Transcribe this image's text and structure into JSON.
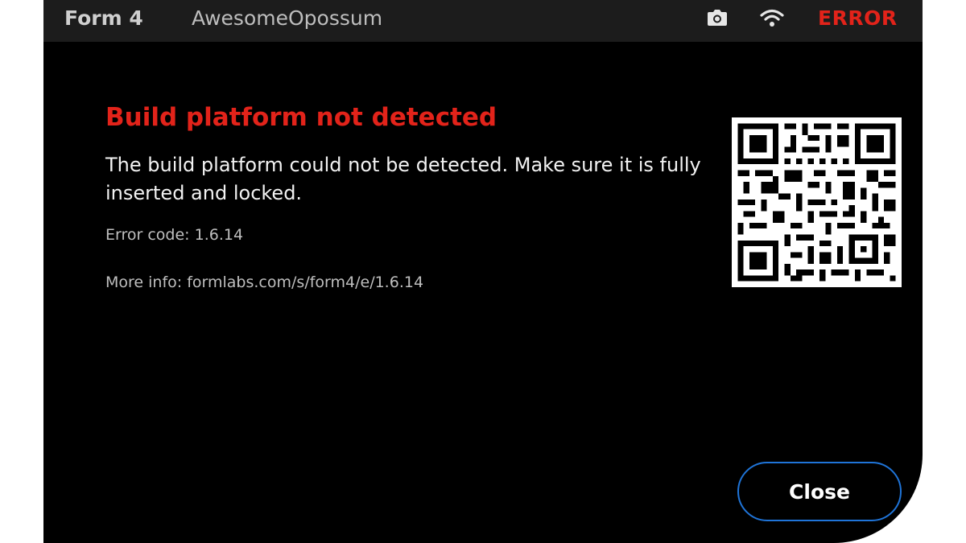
{
  "status_bar": {
    "model": "Form 4",
    "printer_name": "AwesomeOpossum",
    "camera_icon": "camera-icon",
    "wifi_icon": "wifi-icon",
    "status": "ERROR"
  },
  "dialog": {
    "title": "Build platform not detected",
    "description": "The build platform could not be detected. Make sure it is fully inserted and locked.",
    "error_code": "Error code: 1.6.14",
    "more_info": "More info: formlabs.com/s/form4/e/1.6.14",
    "close_label": "Close"
  },
  "colors": {
    "accent_error": "#e2231a",
    "button_border": "#1f74d8",
    "status_bar_bg": "#1c1c1c",
    "screen_bg": "#000000"
  }
}
